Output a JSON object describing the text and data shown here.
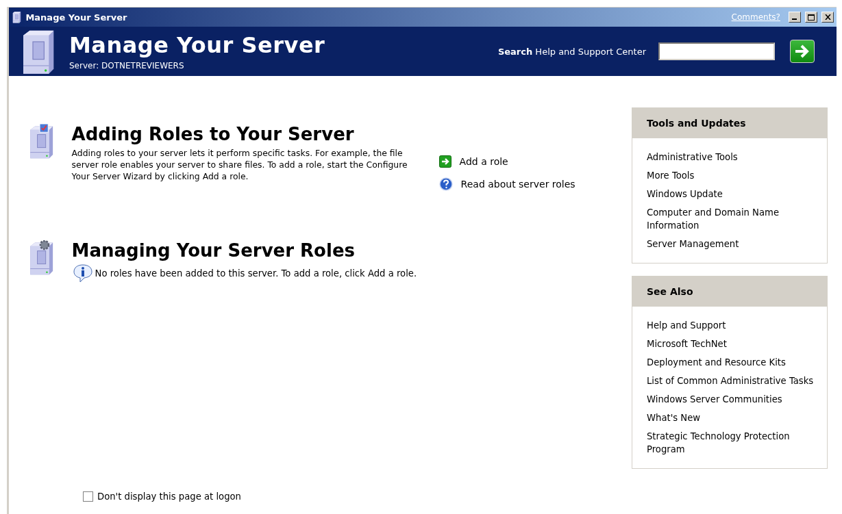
{
  "window": {
    "title": "Manage Your Server",
    "comments_link": "Comments?"
  },
  "header": {
    "title": "Manage Your Server",
    "server_line": "Server: DOTNETREVIEWERS",
    "search": {
      "label_bold": "Search",
      "label_rest": "Help and Support Center"
    }
  },
  "sections": [
    {
      "kind": "adding",
      "title": "Adding Roles to Your Server",
      "description": "Adding roles to your server lets it perform specific tasks. For example, the file server role enables your server to share files. To add a role, start the Configure Your Server Wizard by clicking Add a role.",
      "links": [
        {
          "kind": "go",
          "label": "Add a role"
        },
        {
          "kind": "help",
          "label": "Read about server roles"
        }
      ]
    },
    {
      "kind": "managing",
      "title": "Managing Your Server Roles",
      "note": "No roles have been added to this server. To add a role, click Add a role."
    }
  ],
  "logon_checkbox": {
    "label": "Don't display this page at logon",
    "checked": false
  },
  "panels": [
    {
      "title": "Tools and Updates",
      "links": [
        "Administrative Tools",
        "More Tools",
        "Windows Update",
        "Computer and Domain Name Information",
        "Server Management"
      ]
    },
    {
      "title": "See Also",
      "links": [
        "Help and Support",
        "Microsoft TechNet",
        "Deployment and Resource Kits",
        "List of Common Administrative Tasks",
        "Windows Server Communities",
        "What's New",
        "Strategic Technology Protection Program"
      ]
    }
  ]
}
